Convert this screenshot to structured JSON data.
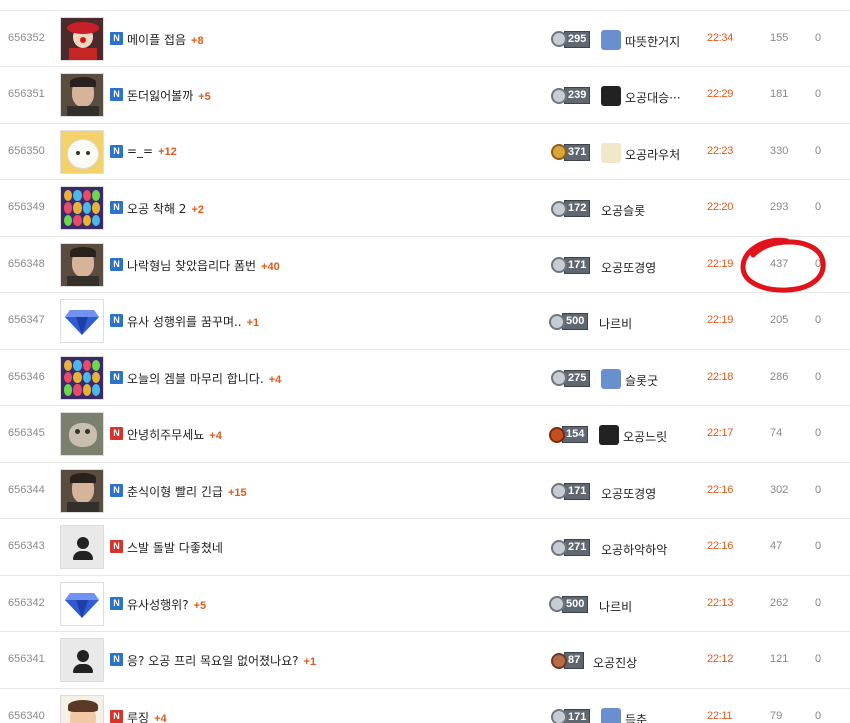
{
  "colors": {
    "accent": "#e05a1a",
    "badge_blue": "#2a73c9",
    "badge_red": "#d8332a",
    "annotation": "#e0121a"
  },
  "posts": [
    {
      "num": "656352",
      "badge": "N",
      "badge_color": "blue",
      "title": "메이플 접음",
      "count": "+8",
      "level": "295",
      "nick": "따뜻한거지",
      "time": "22:34",
      "views": "155",
      "votes": "0",
      "thumb_icon": "clown-icon",
      "avatar": true
    },
    {
      "num": "656351",
      "badge": "N",
      "badge_color": "blue",
      "title": "돈더잃어볼까",
      "count": "+5",
      "level": "239",
      "nick": "오공대승···",
      "time": "22:29",
      "views": "181",
      "votes": "0",
      "thumb_icon": "man-portrait-icon",
      "avatar": true
    },
    {
      "num": "656350",
      "badge": "N",
      "badge_color": "blue",
      "title": "=_=",
      "count": "+12",
      "level": "371",
      "nick": "오공라우처",
      "time": "22:23",
      "views": "330",
      "votes": "0",
      "thumb_icon": "white-creature-icon",
      "avatar": true
    },
    {
      "num": "656349",
      "badge": "N",
      "badge_color": "blue",
      "title": "오공 착해 2",
      "count": "+2",
      "level": "172",
      "nick": "오공슬롯",
      "time": "22:20",
      "views": "293",
      "votes": "0",
      "thumb_icon": "slot-game-icon",
      "avatar": false
    },
    {
      "num": "656348",
      "badge": "N",
      "badge_color": "blue",
      "title": "나락형님 찾았읍리다 폼번",
      "count": "+40",
      "level": "171",
      "nick": "오공또경영",
      "time": "22:19",
      "views": "437",
      "votes": "0",
      "thumb_icon": "man-portrait-icon",
      "avatar": false
    },
    {
      "num": "656347",
      "badge": "N",
      "badge_color": "blue",
      "title": "유사 성행위를 꿈꾸며..",
      "count": "+1",
      "level": "500",
      "nick": "나르비",
      "time": "22:19",
      "views": "205",
      "votes": "0",
      "thumb_icon": "blue-diamond-icon",
      "avatar": false
    },
    {
      "num": "656346",
      "badge": "N",
      "badge_color": "blue",
      "title": "오늘의 겜블 마무리 합니다.",
      "count": "+4",
      "level": "275",
      "nick": "슬롯굿",
      "time": "22:18",
      "views": "286",
      "votes": "0",
      "thumb_icon": "slot-game-icon",
      "avatar": true
    },
    {
      "num": "656345",
      "badge": "N",
      "badge_color": "red",
      "title": "안녕히주무세뇨",
      "count": "+4",
      "level": "154",
      "nick": "오공느릿",
      "time": "22:17",
      "views": "74",
      "votes": "0",
      "thumb_icon": "animal-photo-icon",
      "avatar": true
    },
    {
      "num": "656344",
      "badge": "N",
      "badge_color": "blue",
      "title": "춘식이형 빨리 긴급",
      "count": "+15",
      "level": "171",
      "nick": "오공또경영",
      "time": "22:16",
      "views": "302",
      "votes": "0",
      "thumb_icon": "man-portrait-icon",
      "avatar": false
    },
    {
      "num": "656343",
      "badge": "N",
      "badge_color": "red",
      "title": "스발 돌발 다좋쳤네",
      "count": "",
      "level": "271",
      "nick": "오공하악하악",
      "time": "22:16",
      "views": "47",
      "votes": "0",
      "thumb_icon": "default-user-icon",
      "avatar": false
    },
    {
      "num": "656342",
      "badge": "N",
      "badge_color": "blue",
      "title": "유사성행위?",
      "count": "+5",
      "level": "500",
      "nick": "나르비",
      "time": "22:13",
      "views": "262",
      "votes": "0",
      "thumb_icon": "blue-diamond-icon",
      "avatar": false
    },
    {
      "num": "656341",
      "badge": "N",
      "badge_color": "blue",
      "title": "응? 오공 프리 목요일 없어졌나요?",
      "count": "+1",
      "level": "87",
      "nick": "오공진상",
      "time": "22:12",
      "views": "121",
      "votes": "0",
      "thumb_icon": "default-user-icon",
      "avatar": false
    },
    {
      "num": "656340",
      "badge": "N",
      "badge_color": "red",
      "title": "루징",
      "count": "+4",
      "level": "171",
      "nick": "득춘",
      "time": "22:11",
      "views": "79",
      "votes": "0",
      "thumb_icon": "cartoon-boy-icon",
      "avatar": true
    }
  ]
}
